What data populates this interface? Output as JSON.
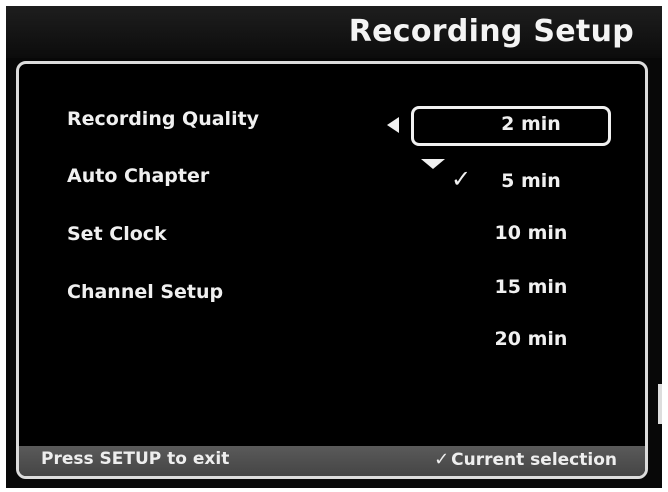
{
  "title": "Recording Setup",
  "menu": {
    "items": [
      {
        "label": "Recording Quality"
      },
      {
        "label": "Auto Chapter"
      },
      {
        "label": "Set Clock"
      },
      {
        "label": "Channel Setup"
      }
    ]
  },
  "options": {
    "items": [
      {
        "label": "2 min"
      },
      {
        "label": "5 min"
      },
      {
        "label": "10 min"
      },
      {
        "label": "15 min"
      },
      {
        "label": "20 min"
      }
    ],
    "highlighted": "2 min",
    "current": "5 min"
  },
  "footer": {
    "exit_hint": "Press SETUP to exit",
    "legend": "Current selection"
  },
  "icons": {
    "check": "checkmark-icon",
    "left": "left-arrow-icon",
    "down": "down-arrow-icon"
  }
}
